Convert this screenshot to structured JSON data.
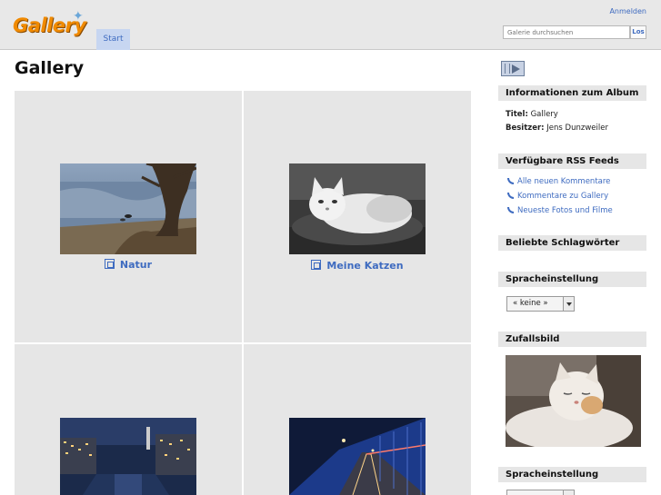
{
  "header": {
    "logo_text": "Gallery",
    "tab_start": "Start",
    "login": "Anmelden",
    "search_placeholder": "Galerie durchsuchen",
    "search_button": "Los"
  },
  "main": {
    "title": "Gallery",
    "albums": [
      {
        "label": "Natur",
        "image": "lake-tree-photo"
      },
      {
        "label": "Meine Katzen",
        "image": "cat-bw-photo"
      },
      {
        "label": "",
        "image": "city-night-river-photo"
      },
      {
        "label": "",
        "image": "night-bridge-photo"
      }
    ]
  },
  "sidebar": {
    "slideshow_icon": "slideshow-icon",
    "info_head": "Informationen zum Album",
    "title_label": "Titel:",
    "title_value": "Gallery",
    "owner_label": "Besitzer:",
    "owner_value": "Jens Dunzweiler",
    "rss_head": "Verfügbare RSS Feeds",
    "rss_links": [
      "Alle neuen Kommentare",
      "Kommentare zu Gallery",
      "Neueste Fotos und Filme"
    ],
    "tags_head": "Beliebte Schlagwörter",
    "lang_head": "Spracheinstellung",
    "lang_value": "« keine »",
    "random_head": "Zufallsbild",
    "lang_head_2": "Spracheinstellung"
  },
  "colors": {
    "accent": "#3e6bc0",
    "header_bg": "#e8e8e8",
    "panel_bg": "#e6e6e6",
    "logo": "#f08a00"
  }
}
